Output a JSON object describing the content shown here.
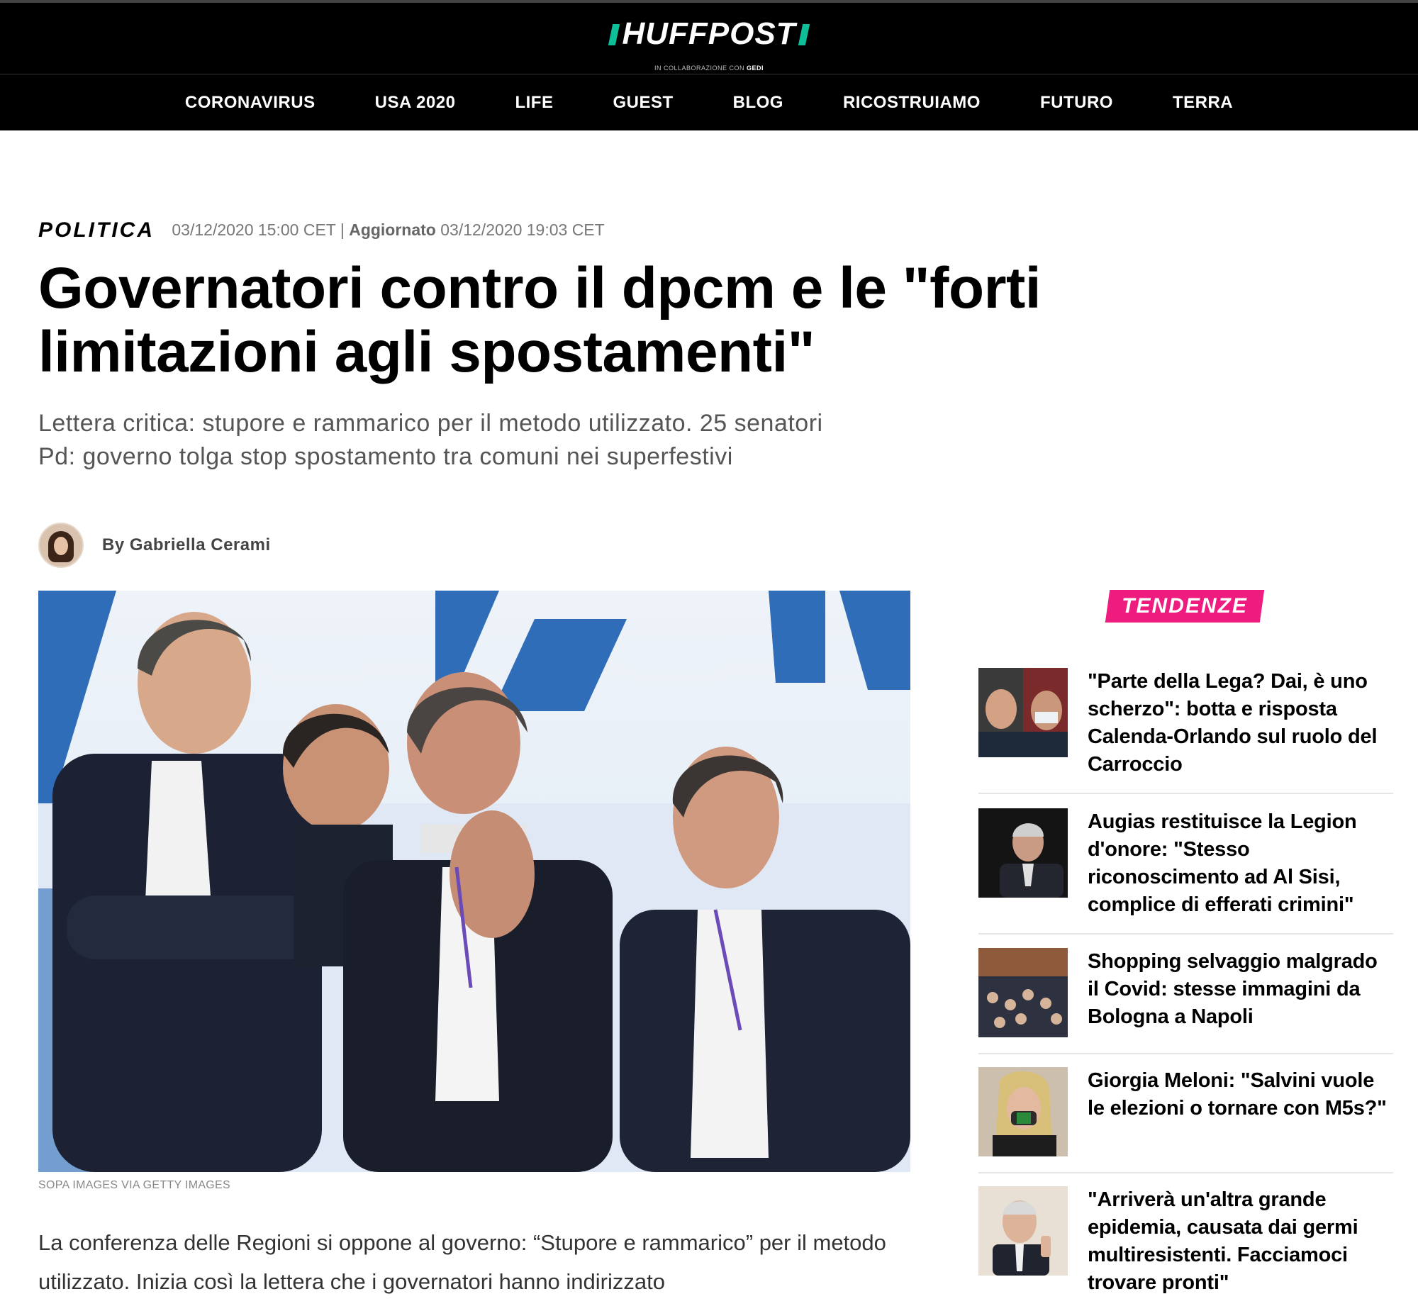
{
  "brand": {
    "logo": "HUFFPOST",
    "tagline_pre": "IN COLLABORAZIONE CON",
    "tagline_partner": "GEDI"
  },
  "nav": [
    "CORONAVIRUS",
    "USA 2020",
    "LIFE",
    "GUEST",
    "BLOG",
    "RICOSTRUIAMO",
    "FUTURO",
    "TERRA"
  ],
  "article": {
    "section": "POLITICA",
    "published": "03/12/2020 15:00 CET",
    "separator": "|",
    "updated_label": "Aggiornato",
    "updated": "03/12/2020 19:03 CET",
    "headline": "Governatori contro il dpcm e le \"forti limitazioni agli spostamenti\"",
    "subhead": "Lettera critica: stupore e rammarico per il metodo utilizzato. 25 senatori Pd: governo tolga stop spostamento tra comuni nei superfestivi",
    "byline": "By Gabriella Cerami",
    "image_caption": "SOPA IMAGES VIA GETTY IMAGES",
    "body": "La conferenza delle Regioni si oppone al governo: “Stupore e rammarico” per il metodo utilizzato. Inizia così la lettera che i governatori hanno indirizzato"
  },
  "sidebar": {
    "label": "TENDENZE",
    "items": [
      {
        "title": "\"Parte della Lega? Dai, è uno scherzo\": botta e risposta Calenda-Orlando sul ruolo del Carroccio"
      },
      {
        "title": "Augias restituisce la Legion d'onore: \"Stesso riconoscimento ad Al Sisi, complice di efferati crimini\""
      },
      {
        "title": "Shopping selvaggio malgrado il Covid: stesse immagini da Bologna a Napoli"
      },
      {
        "title": "Giorgia Meloni: \"Salvini vuole le elezioni o tornare con M5s?\""
      },
      {
        "title": "\"Arriverà un'altra grande epidemia, causata dai germi multiresistenti. Facciamoci trovare pronti\""
      }
    ]
  },
  "colors": {
    "accent_green": "#0dbe98",
    "accent_pink": "#ef1c80",
    "header_bg": "#000000"
  }
}
